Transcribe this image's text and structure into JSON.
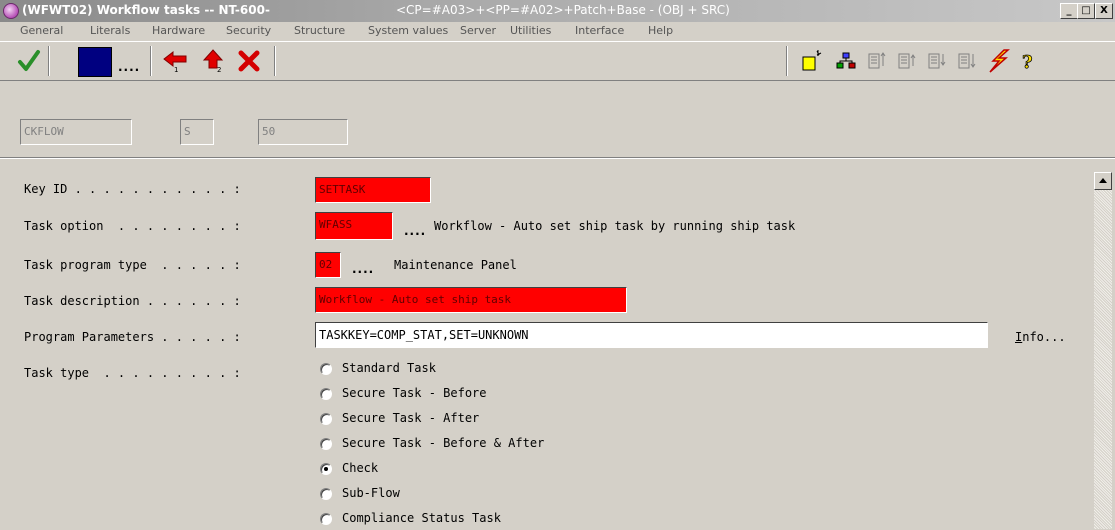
{
  "window": {
    "title": "(WFWT02) Workflow tasks -- NT-600-",
    "title_extra": "<CP=#A03>+<PP=#A02>+Patch+Base - (OBJ + SRC)",
    "minimize": "_",
    "maximize": "□",
    "close": "X"
  },
  "menu": [
    "General",
    "Literals",
    "Hardware",
    "Security",
    "Structure",
    "System values",
    "Server",
    "Utilities",
    "Interface",
    "Help"
  ],
  "toolbar": {
    "confirm_icon": "checkmark-icon",
    "color_box_icon": "color-square-icon",
    "more_label": "....",
    "icons": [
      "prev-arrow-icon",
      "up-arrow-icon",
      "delete-icon",
      "new-doc-icon",
      "hierarchy-icon",
      "sort-icon-1",
      "sort-icon-2",
      "sort-icon-3",
      "sort-icon-4",
      "lightning-icon",
      "help-icon"
    ]
  },
  "header": {
    "field1": "CKFLOW",
    "field2": "S",
    "field3": "50"
  },
  "form": {
    "key_id_label": "Key ID . . . . . . . . . . . :",
    "key_id_value": "SETTASK",
    "task_option_label": "Task option  . . . . . . . . :",
    "task_option_value": "WFASS",
    "task_option_more": "....",
    "task_option_desc": "Workflow - Auto set ship task by running ship task",
    "program_type_label": "Task program type  . . . . . :",
    "program_type_value": "02",
    "program_type_more": "....",
    "program_type_desc": "Maintenance Panel",
    "task_desc_label": "Task description . . . . . . :",
    "task_desc_value": "Workflow - Auto set ship task",
    "params_label": "Program Parameters . . . . . :",
    "params_value": "TASKKEY=COMP_STAT,SET=UNKNOWN",
    "info_link_first": "I",
    "info_link_rest": "nfo...",
    "task_type_label": "Task type  . . . . . . . . . :",
    "task_types": [
      {
        "label": "Standard Task",
        "checked": false
      },
      {
        "label": "Secure Task - Before",
        "checked": false
      },
      {
        "label": "Secure Task - After",
        "checked": false
      },
      {
        "label": "Secure Task - Before & After",
        "checked": false
      },
      {
        "label": "Check",
        "checked": true
      },
      {
        "label": "Sub-Flow",
        "checked": false
      },
      {
        "label": "Compliance Status Task",
        "checked": false
      }
    ]
  },
  "colors": {
    "required_field_bg": "#ff0000",
    "window_bg": "#d4d0c8",
    "color_box": "#000080"
  }
}
